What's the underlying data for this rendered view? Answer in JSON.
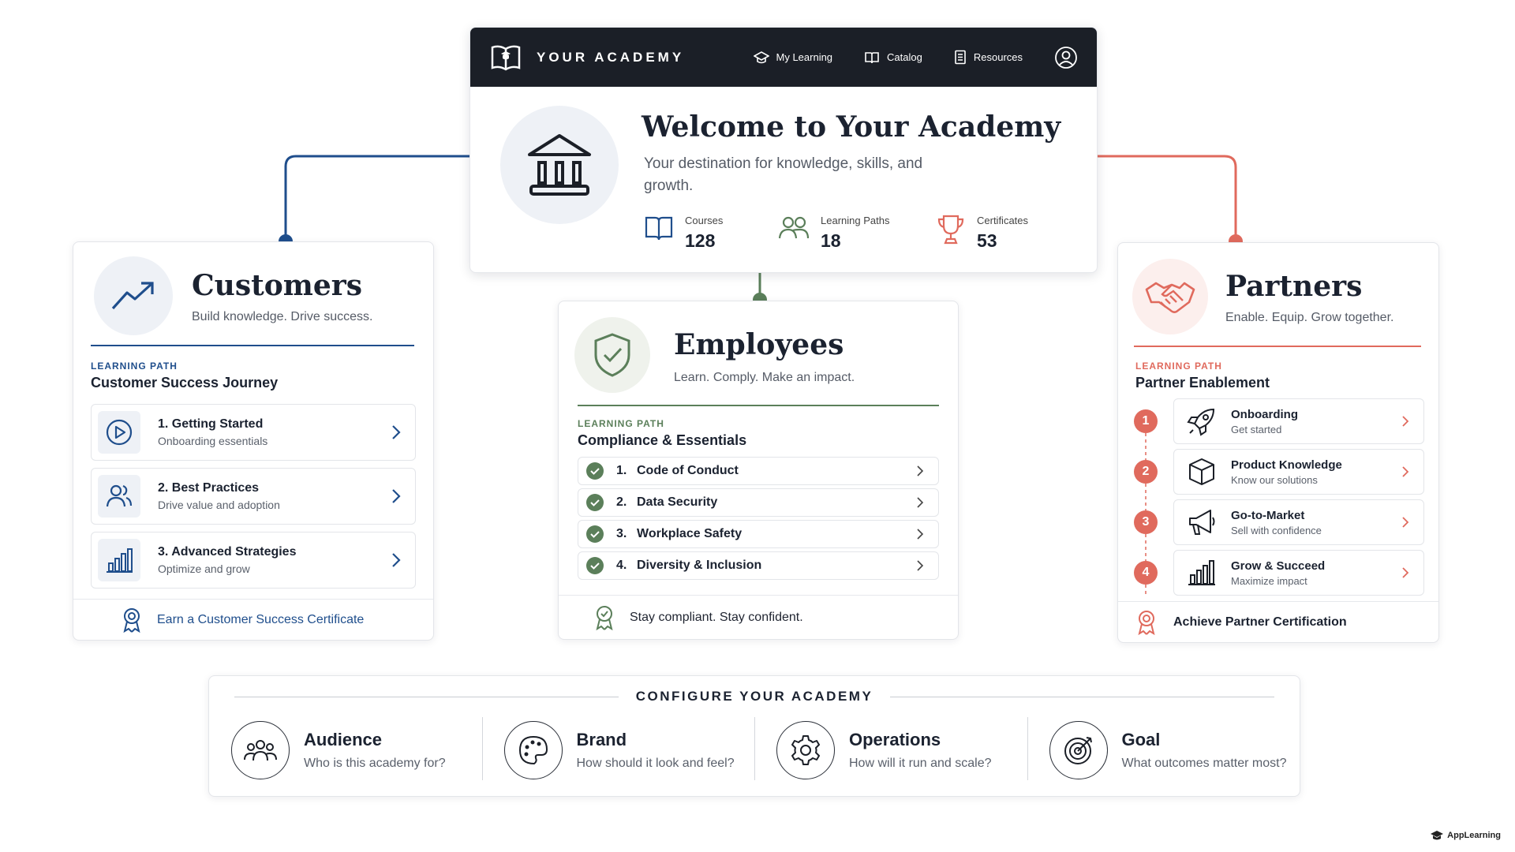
{
  "colors": {
    "customers": "#1f4e8c",
    "employees": "#5b7f5a",
    "partners": "#e06a5d",
    "dark": "#1b1f27"
  },
  "header": {
    "brand": "YOUR ACADEMY",
    "brand_icon": "book-icon",
    "nav": [
      {
        "label": "My Learning",
        "icon": "graduation-cap-icon"
      },
      {
        "label": "Catalog",
        "icon": "book-icon"
      },
      {
        "label": "Resources",
        "icon": "document-icon"
      }
    ],
    "profile_icon": "user-avatar-icon"
  },
  "hero": {
    "title": "Welcome to Your Academy",
    "subtitle": "Your destination for knowledge, skills, and growth.",
    "icon": "institution-icon",
    "stats": [
      {
        "label": "Courses",
        "value": "128",
        "icon": "book-icon"
      },
      {
        "label": "Learning Paths",
        "value": "18",
        "icon": "people-icon"
      },
      {
        "label": "Certificates",
        "value": "53",
        "icon": "trophy-icon"
      }
    ]
  },
  "customers": {
    "title": "Customers",
    "tagline": "Build knowledge. Drive success.",
    "icon": "trending-up-icon",
    "path_label": "LEARNING PATH",
    "path_title": "Customer Success Journey",
    "steps": [
      {
        "title": "1. Getting Started",
        "subtitle": "Onboarding essentials",
        "icon": "play-icon"
      },
      {
        "title": "2. Best Practices",
        "subtitle": "Drive value and adoption",
        "icon": "users-icon"
      },
      {
        "title": "3. Advanced Strategies",
        "subtitle": "Optimize and grow",
        "icon": "bar-chart-icon"
      }
    ],
    "footer": "Earn a Customer Success Certificate"
  },
  "employees": {
    "title": "Employees",
    "tagline": "Learn. Comply. Make an impact.",
    "icon": "shield-check-icon",
    "path_label": "LEARNING PATH",
    "path_title": "Compliance & Essentials",
    "steps": [
      {
        "num": "1.",
        "title": "Code of Conduct"
      },
      {
        "num": "2.",
        "title": "Data Security"
      },
      {
        "num": "3.",
        "title": "Workplace Safety"
      },
      {
        "num": "4.",
        "title": "Diversity & Inclusion"
      }
    ],
    "footer": "Stay compliant. Stay confident."
  },
  "partners": {
    "title": "Partners",
    "tagline": "Enable. Equip. Grow together.",
    "icon": "handshake-icon",
    "path_label": "LEARNING PATH",
    "path_title": "Partner Enablement",
    "steps": [
      {
        "num": "1",
        "title": "Onboarding",
        "subtitle": "Get started",
        "icon": "rocket-icon"
      },
      {
        "num": "2",
        "title": "Product Knowledge",
        "subtitle": "Know our solutions",
        "icon": "box-icon"
      },
      {
        "num": "3",
        "title": "Go-to-Market",
        "subtitle": "Sell with confidence",
        "icon": "megaphone-icon"
      },
      {
        "num": "4",
        "title": "Grow & Succeed",
        "subtitle": "Maximize impact",
        "icon": "bar-chart-icon"
      }
    ],
    "footer": "Achieve Partner Certification"
  },
  "configure": {
    "title": "CONFIGURE YOUR ACADEMY",
    "items": [
      {
        "title": "Audience",
        "subtitle": "Who is this academy for?",
        "icon": "group-icon"
      },
      {
        "title": "Brand",
        "subtitle": "How should it look and feel?",
        "icon": "palette-icon"
      },
      {
        "title": "Operations",
        "subtitle": "How will it run and scale?",
        "icon": "gear-icon"
      },
      {
        "title": "Goal",
        "subtitle": "What outcomes matter most?",
        "icon": "target-icon"
      }
    ]
  },
  "footer_brand": "AppLearning"
}
